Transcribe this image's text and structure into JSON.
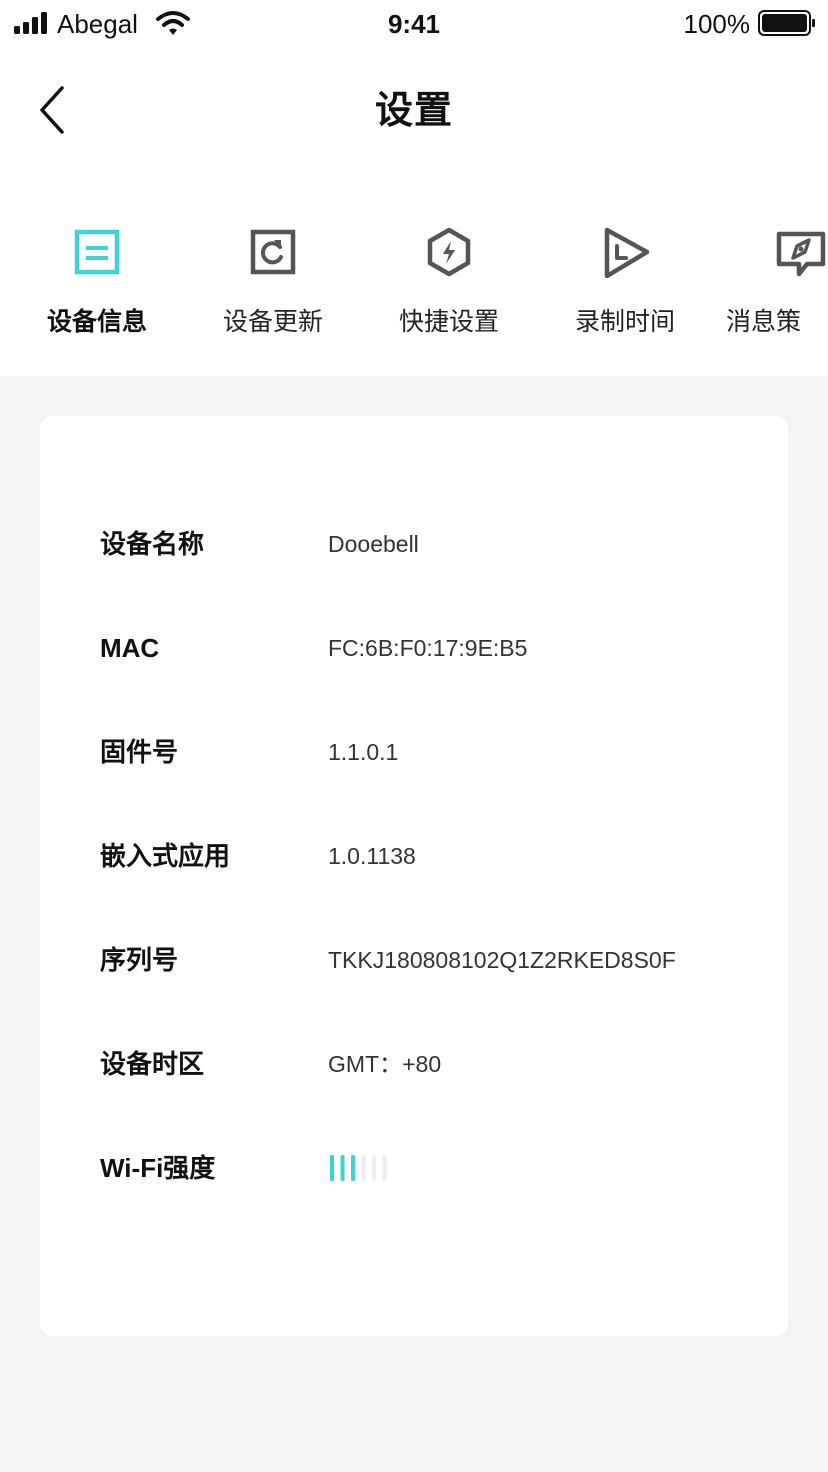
{
  "status_bar": {
    "carrier": "Abegal",
    "time": "9:41",
    "battery": "100%"
  },
  "nav": {
    "title": "设置",
    "back_icon": "chevron-left-icon"
  },
  "tabs": [
    {
      "label": "设备信息",
      "icon": "document-icon",
      "active": true
    },
    {
      "label": "设备更新",
      "icon": "refresh-icon",
      "active": false
    },
    {
      "label": "快捷设置",
      "icon": "lightning-hexagon-icon",
      "active": false
    },
    {
      "label": "录制时间",
      "icon": "play-timer-icon",
      "active": false
    },
    {
      "label": "消息策",
      "icon": "message-compass-icon",
      "active": false
    }
  ],
  "device_info": {
    "rows": [
      {
        "label": "设备名称",
        "value": "Dooebell"
      },
      {
        "label": "MAC",
        "value": "FC:6B:F0:17:9E:B5"
      },
      {
        "label": "固件号",
        "value": "1.1.0.1"
      },
      {
        "label": "嵌入式应用",
        "value": "1.0.1138"
      },
      {
        "label": "序列号",
        "value": "TKKJ180808102Q1Z2RKED8S0F"
      },
      {
        "label": "设备时区",
        "value": "GMT：+80"
      }
    ],
    "wifi": {
      "label": "Wi-Fi强度",
      "level": 3,
      "max_level": 6
    }
  },
  "colors": {
    "accent": "#3fd3d8",
    "icon_gray": "#555555",
    "bar_inactive": "#eeeeee",
    "background": "#f4f4f4"
  }
}
